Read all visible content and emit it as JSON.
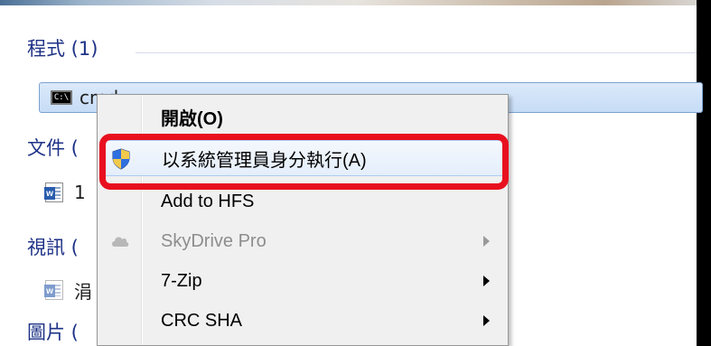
{
  "results": {
    "programs_header": "程式 (1)",
    "cmd_label": "cmd",
    "cmd_icon_text": "C:\\",
    "documents_header": "文件 (",
    "document_item": "1",
    "videos_header": "視訊 (",
    "video_item": "涓",
    "pictures_header": "圖片 ("
  },
  "context_menu": {
    "items": [
      {
        "label": "開啟(O)",
        "style": "bold"
      },
      {
        "label": "以系統管理員身分執行(A)",
        "icon": "uac-shield-icon",
        "style": "highlighted"
      },
      {
        "label": "Add to HFS"
      },
      {
        "label": "SkyDrive Pro",
        "icon": "cloud-icon",
        "style": "disabled",
        "submenu": true
      },
      {
        "label": "7-Zip",
        "submenu": true
      },
      {
        "label": "CRC SHA",
        "submenu": true
      }
    ]
  },
  "colors": {
    "header_text": "#1e3287",
    "annotation_red": "#e8101f",
    "menu_background": "#f0f0f0"
  }
}
